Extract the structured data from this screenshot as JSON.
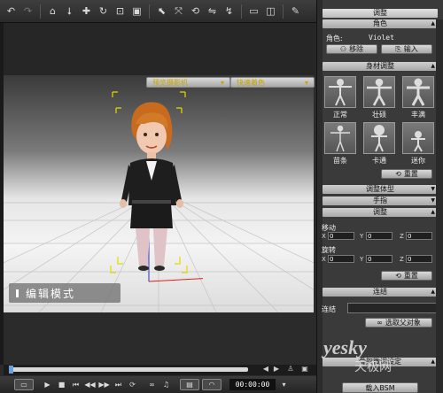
{
  "toolbar": {
    "icons": [
      "undo-icon",
      "redo-icon",
      "home-icon",
      "down-arrow-icon",
      "move-icon",
      "rotate-icon",
      "scale-icon",
      "frame-icon",
      "select-icon",
      "transform-icon",
      "refresh-icon",
      "mirror-icon",
      "pose-icon",
      "camera-icon",
      "view-icon",
      "brush-icon"
    ]
  },
  "viewport": {
    "camera_label": "预览摄影机",
    "shading_label": "快速着色",
    "mode_label": "编辑模式"
  },
  "playback": {
    "time": "00:00:00"
  },
  "panel": {
    "title": "调整",
    "character_header": "角色",
    "character_label": "角色:",
    "character_name": "Violet",
    "remove_button": "移除",
    "import_button": "输入",
    "body_header": "身材调整",
    "presets": [
      {
        "label": "正常"
      },
      {
        "label": "壮硕"
      },
      {
        "label": "丰满"
      },
      {
        "label": "苗条"
      },
      {
        "label": "卡通"
      },
      {
        "label": "迷你"
      }
    ],
    "reset_button": "重置",
    "body_type_header": "调整体型",
    "finger_header": "手指",
    "adjust_header": "调整",
    "move_label": "移动",
    "rotate_label": "旋转",
    "axis": {
      "x": "X",
      "y": "Y",
      "z": "Z"
    },
    "move_values": {
      "x": "0",
      "y": "0",
      "z": "0"
    },
    "rotate_values": {
      "x": "0",
      "y": "0",
      "z": "0"
    },
    "reset_button2": "重置",
    "link_header": "连结",
    "link_label": "连结",
    "pick_parent_button": "选取父对象",
    "skeleton_header": "骨架微调设定",
    "import_bsm_button": "载入BSM"
  },
  "watermark": {
    "brand": "yesky",
    "site": "天极网"
  }
}
